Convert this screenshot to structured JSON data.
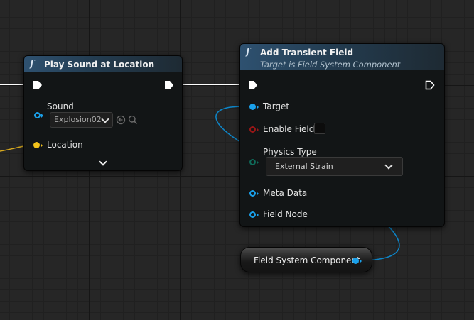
{
  "nodes": {
    "play_sound": {
      "title": "Play Sound at Location",
      "pins": {
        "sound_label": "Sound",
        "sound_value": "Explosion02",
        "location_label": "Location"
      }
    },
    "add_field": {
      "title": "Add Transient Field",
      "subtitle": "Target is Field System Component",
      "pins": {
        "target_label": "Target",
        "enable_label": "Enable Field",
        "enable_checked": false,
        "physics_label": "Physics Type",
        "physics_value": "External Strain",
        "meta_label": "Meta Data",
        "field_node_label": "Field Node"
      }
    },
    "variable": {
      "label": "Field System Component"
    }
  },
  "icons": {
    "function": "f",
    "use_selected": "arrow-left-circle-icon",
    "browse": "magnifier-icon",
    "advanced": "chevron-down-icon"
  },
  "colors": {
    "exec": "#ffffff",
    "object_pin": "#1aa0ea",
    "vector_pin": "#f2c21b",
    "bool_pin": "#9a1717",
    "enum_pin": "#0f6b5a",
    "wire_object": "#0d86c9",
    "wire_vector": "#d8a91e"
  }
}
